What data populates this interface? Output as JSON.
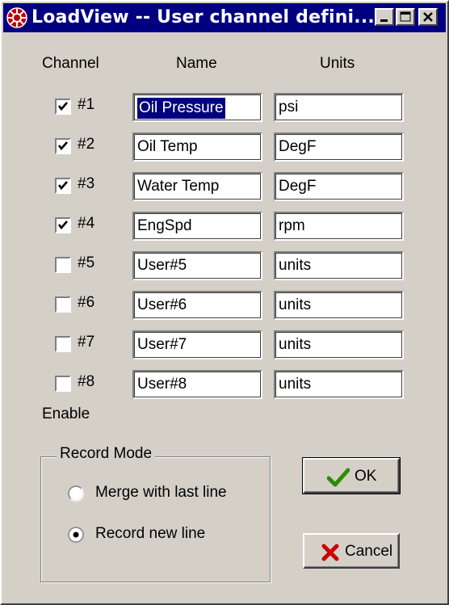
{
  "window": {
    "title": "LoadView -- User channel defini..."
  },
  "headers": {
    "channel": "Channel",
    "name": "Name",
    "units": "Units"
  },
  "channels": [
    {
      "num": "#1",
      "enabled": true,
      "name": "Oil Pressure",
      "units": "psi"
    },
    {
      "num": "#2",
      "enabled": true,
      "name": "Oil Temp",
      "units": "DegF"
    },
    {
      "num": "#3",
      "enabled": true,
      "name": "Water Temp",
      "units": "DegF"
    },
    {
      "num": "#4",
      "enabled": true,
      "name": "EngSpd",
      "units": "rpm"
    },
    {
      "num": "#5",
      "enabled": false,
      "name": "User#5",
      "units": "units"
    },
    {
      "num": "#6",
      "enabled": false,
      "name": "User#6",
      "units": "units"
    },
    {
      "num": "#7",
      "enabled": false,
      "name": "User#7",
      "units": "units"
    },
    {
      "num": "#8",
      "enabled": false,
      "name": "User#8",
      "units": "units"
    }
  ],
  "enable_label": "Enable",
  "record_mode": {
    "title": "Record Mode",
    "options": [
      "Merge with last line",
      "Record new line"
    ],
    "selected": "Record new line"
  },
  "buttons": {
    "ok": "OK",
    "cancel": "Cancel"
  },
  "icons": {
    "app": "loadview-app-icon",
    "ok": "checkmark-icon",
    "cancel": "x-icon"
  },
  "colors": {
    "titlebar": "#000080",
    "face": "#d4d0c8",
    "ok_check": "#2e8b00",
    "cancel_x": "#cc0000"
  }
}
